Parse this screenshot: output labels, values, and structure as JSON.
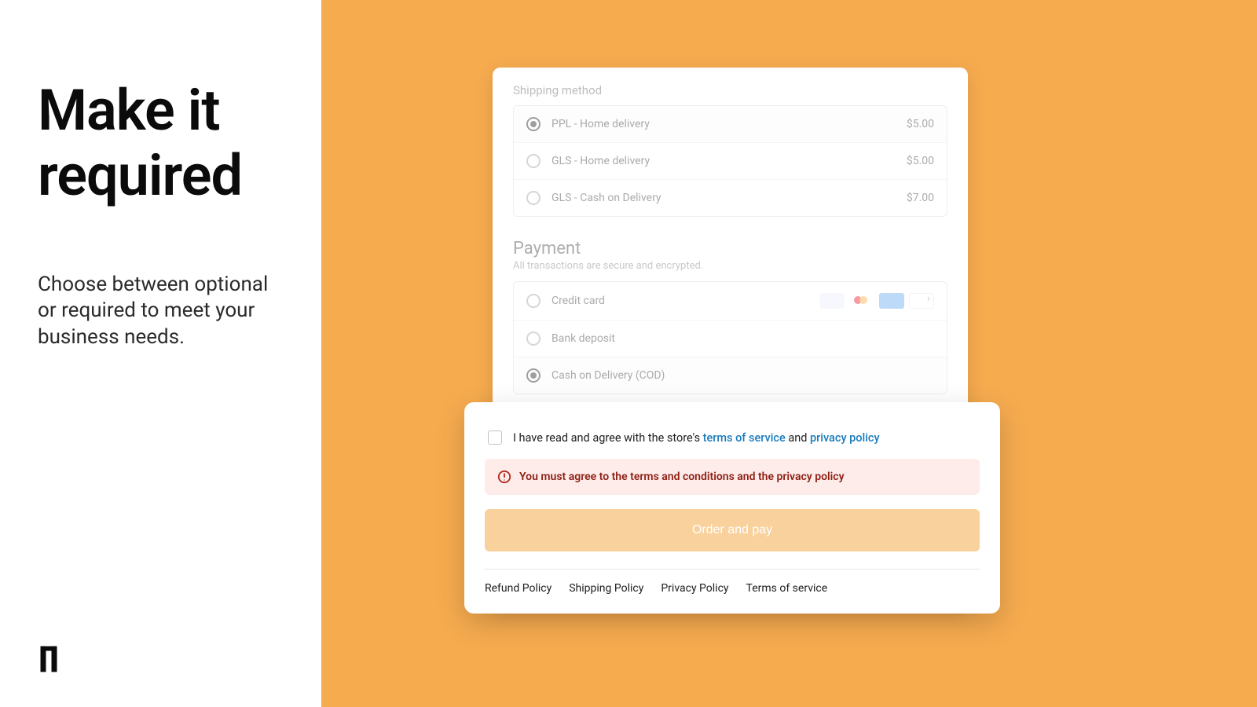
{
  "left": {
    "headline": "Make it required",
    "subhead": "Choose between optional or required to meet your business needs."
  },
  "checkout": {
    "shipping": {
      "title": "Shipping method",
      "options": [
        {
          "label": "PPL - Home delivery",
          "price": "$5.00",
          "selected": true
        },
        {
          "label": "GLS - Home delivery",
          "price": "$5.00",
          "selected": false
        },
        {
          "label": "GLS - Cash on Delivery",
          "price": "$7.00",
          "selected": false
        }
      ]
    },
    "payment": {
      "title": "Payment",
      "note": "All transactions are secure and encrypted.",
      "options": [
        {
          "label": "Credit card",
          "selected": false,
          "logos": true
        },
        {
          "label": "Bank deposit",
          "selected": false
        },
        {
          "label": "Cash on Delivery (COD)",
          "selected": true
        }
      ]
    }
  },
  "consent": {
    "text_before": "I have read and agree with the store's ",
    "link1": "terms of service",
    "text_mid": " and ",
    "link2": "privacy policy",
    "error": "You must agree to the terms and conditions and the privacy policy",
    "button": "Order and pay"
  },
  "footer": {
    "links": [
      "Refund Policy",
      "Shipping Policy",
      "Privacy Policy",
      "Terms of service"
    ]
  }
}
